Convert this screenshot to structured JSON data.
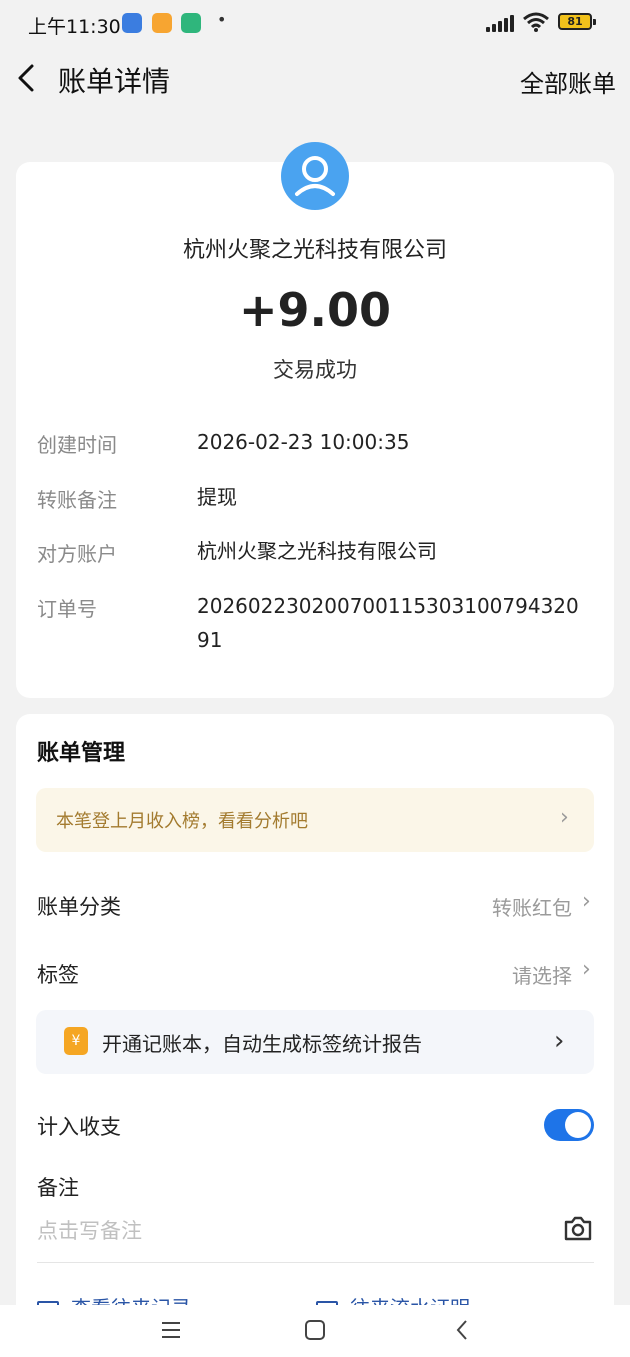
{
  "status_bar": {
    "time": "上午11:30",
    "battery": "81"
  },
  "nav": {
    "title": "账单详情",
    "right_link": "全部账单"
  },
  "transaction": {
    "merchant": "杭州火聚之光科技有限公司",
    "amount": "+9.00",
    "status": "交易成功"
  },
  "details": [
    {
      "label": "创建时间",
      "value": "2026-02-23 10:00:35"
    },
    {
      "label": "转账备注",
      "value": "提现"
    },
    {
      "label": "对方账户",
      "value": "杭州火聚之光科技有限公司"
    },
    {
      "label": "订单号",
      "value": "20260223020070011530310079432091"
    }
  ],
  "manage": {
    "title": "账单管理",
    "promo": "本笔登上月收入榜，看看分析吧",
    "category_label": "账单分类",
    "category_value": "转账红包",
    "tag_label": "标签",
    "tag_value": "请选择",
    "ledger_promo": "开通记账本，自动生成标签统计报告",
    "ledger_icon": "¥",
    "count_label": "计入收支",
    "count_enabled": true,
    "note_label": "备注",
    "note_placeholder": "点击写备注",
    "links": [
      "查看往来记录",
      "往来流水证明"
    ]
  },
  "colors": {
    "accent": "#1e74e8",
    "avatar": "#4aa3f0",
    "promo_text": "#a37b2f"
  }
}
